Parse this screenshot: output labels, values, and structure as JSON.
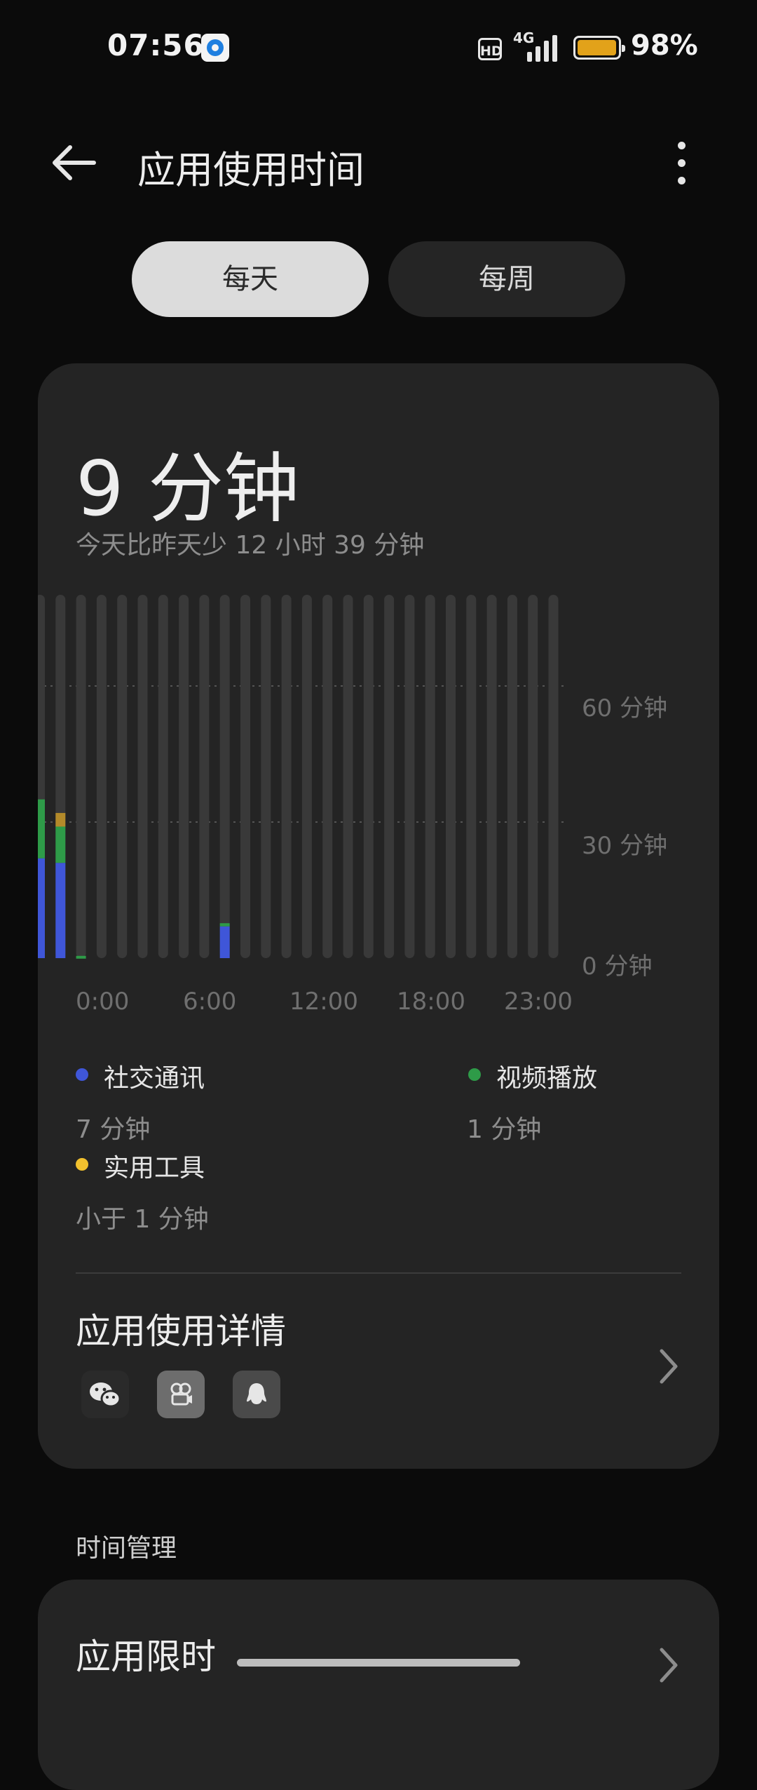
{
  "status": {
    "time": "07:56",
    "hd_label": "HD",
    "network": "4G",
    "battery_level": 0.98,
    "battery_pct": "98%"
  },
  "toolbar": {
    "title": "应用使用时间",
    "back_icon": "arrow-left-icon",
    "more_icon": "more-vertical-icon"
  },
  "tabs": [
    {
      "label": "每天",
      "selected": true
    },
    {
      "label": "每周",
      "selected": false
    }
  ],
  "summary": {
    "total": "9 分钟",
    "compare": "今天比昨天少 12 小时 39 分钟"
  },
  "chart_data": {
    "type": "bar",
    "stacked": true,
    "x_ticks": [
      "0:00",
      "6:00",
      "12:00",
      "18:00",
      "23:00"
    ],
    "y_ticks": [
      "60 分钟",
      "30 分钟",
      "0 分钟"
    ],
    "ylim": [
      0,
      60
    ],
    "grid": true,
    "series": [
      {
        "name": "社交通讯",
        "color": "#3f56d8",
        "values": [
          22,
          21,
          0,
          0,
          0,
          0,
          0,
          0,
          0,
          7,
          0,
          0,
          0,
          0,
          0,
          0,
          0,
          0,
          0,
          0,
          0,
          0,
          0,
          0,
          0,
          0
        ]
      },
      {
        "name": "视频播放",
        "color": "#2e9b48",
        "values": [
          13,
          8,
          0.5,
          0,
          0,
          0,
          0,
          0,
          0,
          0.7,
          0,
          0,
          0,
          0,
          0,
          0,
          0,
          0,
          0,
          0,
          0,
          0,
          0,
          0,
          0,
          0
        ]
      },
      {
        "name": "实用工具",
        "color": "#b38a2a",
        "values": [
          0,
          3,
          0,
          0,
          0,
          0,
          0,
          0,
          0,
          0,
          0,
          0,
          0,
          0,
          0,
          0,
          0,
          0,
          0,
          0,
          0,
          0,
          0,
          0,
          0,
          0
        ]
      }
    ]
  },
  "legend": [
    {
      "label": "社交通讯",
      "value": "7 分钟",
      "color": "#3f56d8"
    },
    {
      "label": "视频播放",
      "value": "1 分钟",
      "color": "#2e9b48"
    },
    {
      "label": "实用工具",
      "value": "小于 1 分钟",
      "color": "#f2c12e"
    }
  ],
  "details": {
    "title": "应用使用详情",
    "app_icons": [
      "wechat-icon",
      "video-app-icon",
      "qq-icon"
    ],
    "chevron_icon": "chevron-right-icon"
  },
  "time_management": {
    "section_label": "时间管理",
    "item_title": "应用限时",
    "chevron_icon": "chevron-right-icon"
  }
}
